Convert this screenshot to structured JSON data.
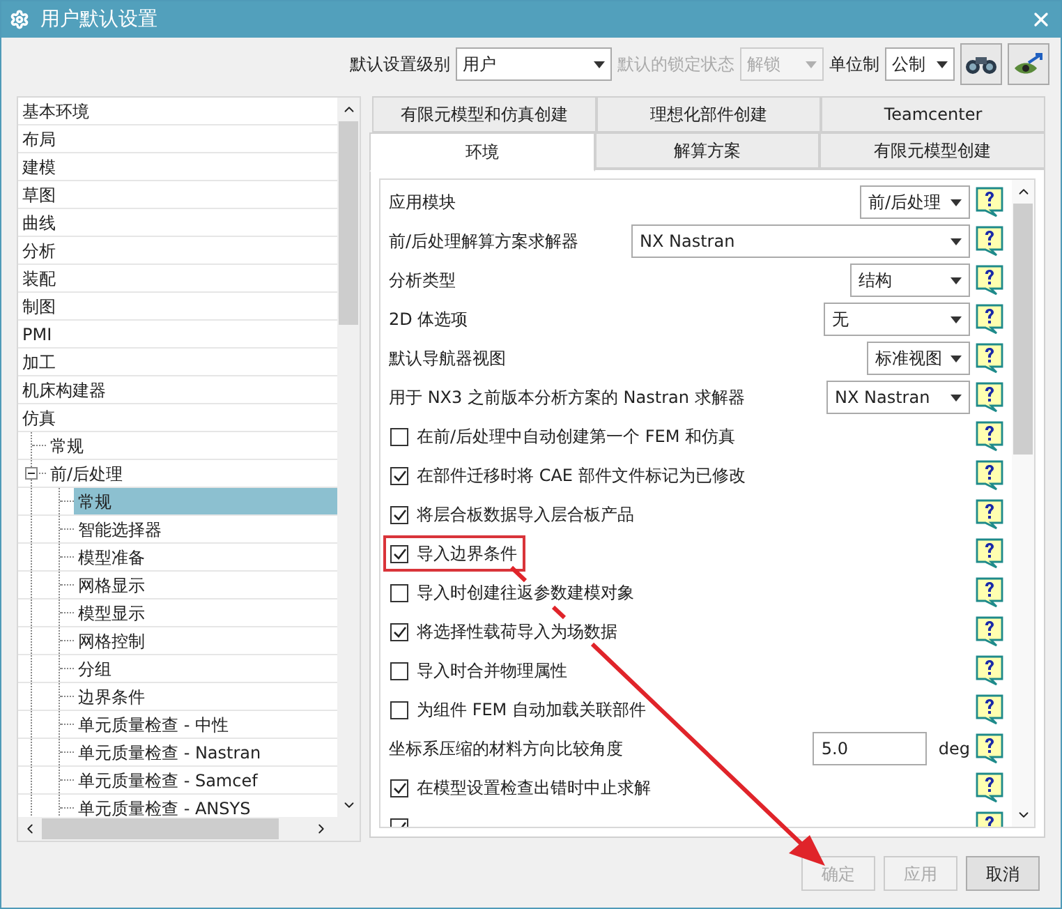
{
  "window": {
    "title": "用户默认设置"
  },
  "toolbar": {
    "level_label": "默认设置级别",
    "level_value": "用户",
    "lock_label": "默认的锁定状态",
    "lock_value": "解锁",
    "lock_disabled": true,
    "unit_label": "单位制",
    "unit_value": "公制"
  },
  "tree": [
    {
      "label": "基本环境",
      "selected": false
    },
    {
      "label": "布局",
      "selected": false
    },
    {
      "label": "建模",
      "selected": false
    },
    {
      "label": "草图",
      "selected": false
    },
    {
      "label": "曲线",
      "selected": false
    },
    {
      "label": "分析",
      "selected": false
    },
    {
      "label": "装配",
      "selected": false
    },
    {
      "label": "制图",
      "selected": false
    },
    {
      "label": "PMI",
      "selected": false
    },
    {
      "label": "加工",
      "selected": false
    },
    {
      "label": "机床构建器",
      "selected": false
    },
    {
      "label": "仿真",
      "selected": false,
      "children": [
        {
          "label": "常规",
          "selected": false
        },
        {
          "label": "前/后处理",
          "selected": false,
          "expanded": true,
          "children": [
            {
              "label": "常规",
              "selected": true
            },
            {
              "label": "智能选择器",
              "selected": false
            },
            {
              "label": "模型准备",
              "selected": false
            },
            {
              "label": "网格显示",
              "selected": false
            },
            {
              "label": "模型显示",
              "selected": false
            },
            {
              "label": "网格控制",
              "selected": false
            },
            {
              "label": "分组",
              "selected": false
            },
            {
              "label": "边界条件",
              "selected": false
            },
            {
              "label": "单元质量检查 - 中性",
              "selected": false
            },
            {
              "label": "单元质量检查 - Nastran",
              "selected": false
            },
            {
              "label": "单元质量检查 - Samcef",
              "selected": false
            },
            {
              "label": "单元质量检查 - ANSYS",
              "selected": false
            }
          ]
        }
      ]
    }
  ],
  "tab_rows": [
    [
      {
        "label": "有限元模型和仿真创建",
        "selected": false
      },
      {
        "label": "理想化部件创建",
        "selected": false
      },
      {
        "label": "Teamcenter",
        "selected": false
      }
    ],
    [
      {
        "label": "环境",
        "selected": true
      },
      {
        "label": "解算方案",
        "selected": false
      },
      {
        "label": "有限元模型创建",
        "selected": false
      }
    ]
  ],
  "settings": [
    {
      "kind": "dropdown",
      "label": "应用模块",
      "value": "前/后处理"
    },
    {
      "kind": "dropdown",
      "label": "前/后处理解算方案求解器",
      "value": "NX Nastran"
    },
    {
      "kind": "dropdown",
      "label": "分析类型",
      "value": "结构"
    },
    {
      "kind": "dropdown",
      "label": "2D 体选项",
      "value": "无"
    },
    {
      "kind": "dropdown",
      "label": "默认导航器视图",
      "value": "标准视图"
    },
    {
      "kind": "dropdown",
      "label": "用于 NX3 之前版本分析方案的 Nastran 求解器",
      "value": "NX Nastran"
    },
    {
      "kind": "checkbox",
      "label": "在前/后处理中自动创建第一个 FEM 和仿真",
      "checked": false
    },
    {
      "kind": "checkbox",
      "label": "在部件迁移时将 CAE 部件文件标记为已修改",
      "checked": true
    },
    {
      "kind": "checkbox",
      "label": "将层合板数据导入层合板产品",
      "checked": true
    },
    {
      "kind": "checkbox",
      "label": "导入边界条件",
      "checked": true,
      "highlighted": true
    },
    {
      "kind": "checkbox",
      "label": "导入时创建往返参数建模对象",
      "checked": false
    },
    {
      "kind": "checkbox",
      "label": "将选择性载荷导入为场数据",
      "checked": true
    },
    {
      "kind": "checkbox",
      "label": "导入时合并物理属性",
      "checked": false
    },
    {
      "kind": "checkbox",
      "label": "为组件 FEM 自动加载关联部件",
      "checked": false
    },
    {
      "kind": "number",
      "label": "坐标系压缩的材料方向比较角度",
      "value": "5.0",
      "unit": "deg"
    },
    {
      "kind": "checkbox",
      "label": "在模型设置检查出错时中止求解",
      "checked": true
    },
    {
      "kind": "checkbox",
      "checked": true
    }
  ],
  "buttons": [
    {
      "label": "确定",
      "disabled": true
    },
    {
      "label": "应用",
      "disabled": true
    },
    {
      "label": "取消",
      "disabled": false
    }
  ]
}
